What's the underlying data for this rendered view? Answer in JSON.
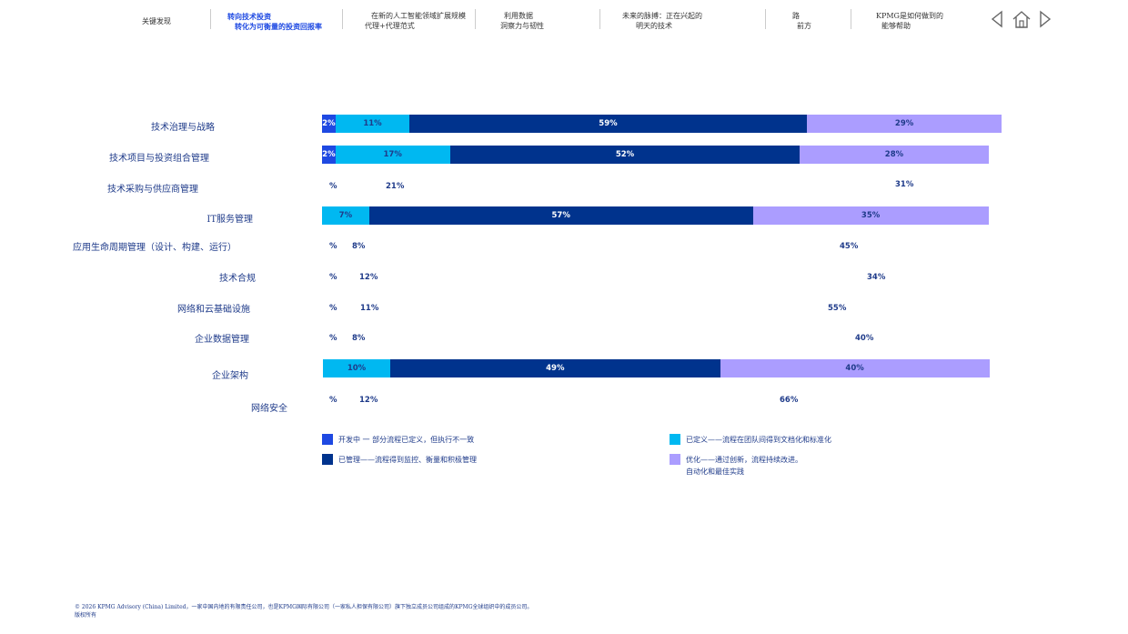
{
  "nav": {
    "items": [
      {
        "line1": "关键发现",
        "line2": ""
      },
      {
        "line1": "转向技术投资",
        "line2": "转化为可衡量的投资回报率"
      },
      {
        "line1": "在新的人工智能领域扩展规模",
        "line2": "代理+代理范式"
      },
      {
        "line1": "利用数据",
        "line2": "洞察力与韧性"
      },
      {
        "line1": "未来的脉搏：正在兴起的",
        "line2": "明天的技术"
      },
      {
        "line1": "路",
        "line2": "前方"
      },
      {
        "line1": "KPMG是如何做到的",
        "line2": "能够帮助"
      }
    ],
    "active_index": 1,
    "icons": [
      "previous-arrow-icon",
      "home-icon",
      "next-arrow-icon"
    ]
  },
  "chart_data": {
    "type": "bar",
    "orientation": "horizontal-stacked",
    "categories": [
      "技术治理与战略",
      "技术项目与投资组合管理",
      "技术采购与供应商管理",
      "IT服务管理",
      "应用生命周期管理（设计、构建、运行）",
      "技术合规",
      "网络和云基础设施",
      "企业数据管理",
      "企业架构",
      "网络安全"
    ],
    "series": [
      {
        "name": "开发中 一 部分流程已定义，但执行不一致",
        "color": "#1e49e2",
        "values": [
          2,
          2,
          null,
          0,
          null,
          null,
          null,
          null,
          0,
          null
        ],
        "labels": [
          "2%",
          "2%",
          "%",
          "",
          "%",
          "%",
          "%",
          "%",
          "",
          "%"
        ]
      },
      {
        "name": "已定义——流程在团队间得到文档化和标准化",
        "color": "#00b8f1",
        "values": [
          11,
          17,
          21,
          7,
          8,
          12,
          11,
          8,
          10,
          12
        ],
        "labels": [
          "11%",
          "17%",
          "21%",
          "7%",
          "8%",
          "12%",
          "11%",
          "8%",
          "10%",
          "12%"
        ]
      },
      {
        "name": "已管理——流程得到监控、衡量和积极管理",
        "color": "#00338d",
        "values": [
          59,
          52,
          null,
          57,
          null,
          null,
          null,
          null,
          49,
          null
        ],
        "labels": [
          "59%",
          "52%",
          "",
          "57%",
          "",
          "",
          "",
          "",
          "49%",
          ""
        ]
      },
      {
        "name": "优化——通过创新，流程持续改进。",
        "name_line2": "自动化和最佳实践",
        "color": "#ab9dff",
        "values": [
          29,
          28,
          31,
          35,
          45,
          34,
          55,
          40,
          40,
          66
        ],
        "labels": [
          "29%",
          "28%",
          "31%",
          "35%",
          "45%",
          "34%",
          "55%",
          "40%",
          "40%",
          "66%"
        ]
      }
    ],
    "bars_visible": [
      true,
      true,
      false,
      true,
      false,
      false,
      false,
      false,
      true,
      false
    ],
    "xlim": [
      0,
      100
    ],
    "grid": false,
    "legend": "bottom"
  },
  "footer": {
    "line1": "© 2026 KPMG Advisory (China) Limited，一家中国内地的有限责任公司，也是KPMG国际有限公司（一家私人担保有限公司）旗下独立成员公司组成的KPMG全球组织中的成员公司。",
    "line2": "版权所有"
  }
}
